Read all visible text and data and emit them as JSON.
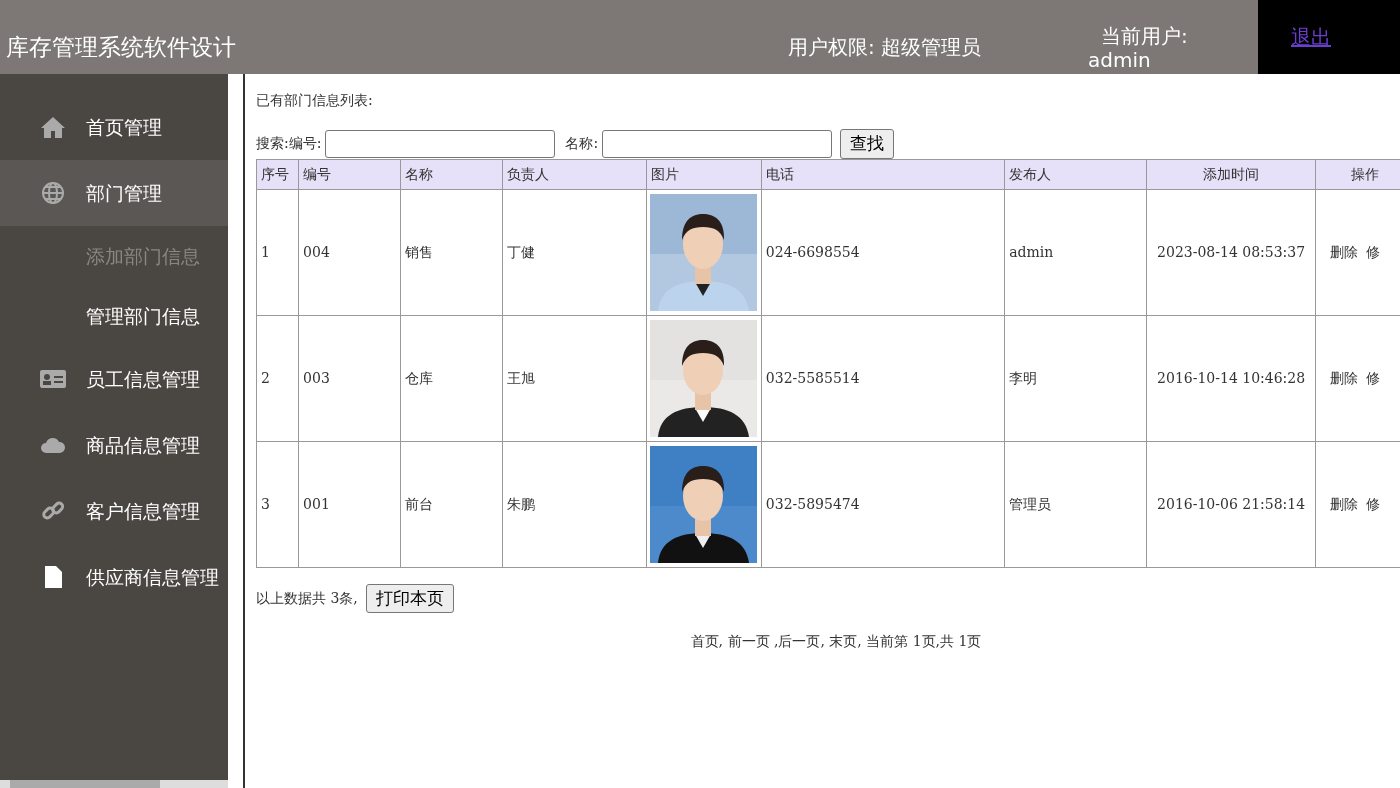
{
  "header": {
    "title": "库存管理系统软件设计",
    "role": "用户权限: 超级管理员",
    "user_label": "当前用户:",
    "user": "admin",
    "logout": "退出"
  },
  "sidebar": {
    "items": [
      {
        "label": "首页管理",
        "selected": false
      },
      {
        "label": "部门管理",
        "selected": true,
        "children": [
          {
            "label": "添加部门信息",
            "muted": true
          },
          {
            "label": "管理部门信息",
            "muted": false
          }
        ]
      },
      {
        "label": "员工信息管理",
        "selected": false
      },
      {
        "label": "商品信息管理",
        "selected": false
      },
      {
        "label": "客户信息管理",
        "selected": false
      },
      {
        "label": "供应商信息管理",
        "selected": false
      }
    ]
  },
  "heading": "已有部门信息列表:",
  "search": {
    "label": "搜索:编号:",
    "name_label": "名称:",
    "button": "查找"
  },
  "table": {
    "columns": [
      "序号",
      "编号",
      "名称",
      "负责人",
      "图片",
      "电话",
      "发布人",
      "添加时间",
      "操作"
    ],
    "rows": [
      {
        "index": "1",
        "code": "004",
        "name": "销售",
        "manager": "丁健",
        "phone": "024-6698554",
        "publisher": "admin",
        "time": "2023-08-14 08:53:37",
        "actions": [
          "删除",
          "修"
        ]
      },
      {
        "index": "2",
        "code": "003",
        "name": "仓库",
        "manager": "王旭",
        "phone": "032-5585514",
        "publisher": "李明",
        "time": "2016-10-14 10:46:28",
        "actions": [
          "删除",
          "修"
        ]
      },
      {
        "index": "3",
        "code": "001",
        "name": "前台",
        "manager": "朱鹏",
        "phone": "032-5895474",
        "publisher": "管理员",
        "time": "2016-10-06 21:58:14",
        "actions": [
          "删除",
          "修"
        ]
      }
    ]
  },
  "summary": "以上数据共 3条,",
  "print_button": "打印本页",
  "pagination": "首页,  前一页 ,后一页,  末页,  当前第 1页,共 1页"
}
